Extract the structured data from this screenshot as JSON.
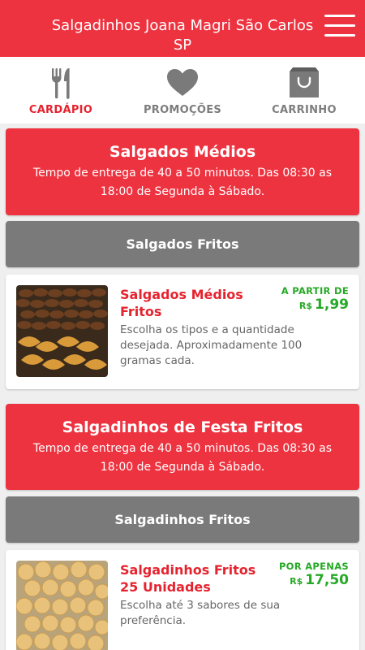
{
  "header": {
    "title": "Salgadinhos Joana Magri São Carlos SP"
  },
  "tabs": [
    {
      "label": "CARDÁPIO",
      "icon": "fork-knife-icon",
      "active": true
    },
    {
      "label": "PROMOÇÕES",
      "icon": "heart-icon",
      "active": false
    },
    {
      "label": "CARRINHO",
      "icon": "shopping-bag-icon",
      "active": false
    }
  ],
  "colors": {
    "brand_red": "#ee3340",
    "section_gray": "#7a7a7a",
    "price_green": "#26a926",
    "tab_inactive": "#7d7d7d"
  },
  "sections": [
    {
      "title": "Salgados Médios",
      "description": "Tempo de entrega de 40 a 50 minutos. Das 08:30 as 18:00 de Segunda à Sábado.",
      "subcategory": "Salgados Fritos",
      "product": {
        "name": "Salgados Médios Fritos",
        "description": "Escolha os tipos e a quantidade desejada. Aproximadamente 100 gramas cada.",
        "price_label": "A PARTIR DE",
        "currency": "R$",
        "price": "1,99"
      }
    },
    {
      "title": "Salgadinhos de Festa Fritos",
      "description": "Tempo de entrega de 40 a 50 minutos. Das 08:30 as 18:00 de Segunda à Sábado.",
      "subcategory": "Salgadinhos Fritos",
      "product": {
        "name": "Salgadinhos Fritos 25 Unidades",
        "description": "Escolha até 3 sabores de sua preferência.",
        "price_label": "POR APENAS",
        "currency": "R$",
        "price": "17,50"
      }
    }
  ]
}
